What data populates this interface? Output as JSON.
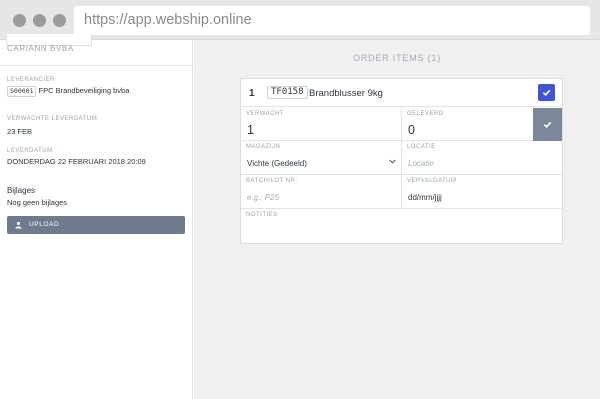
{
  "browser": {
    "url": "https://app.webship.online"
  },
  "sidebar": {
    "company": "CARIANN BVBA",
    "leverancier_label": "LEVERANCIER",
    "leverancier_code": "S00001",
    "leverancier_name": "FPC Brandbeveiliging bvba",
    "verwachte_label": "VERWACHTE LEVERDATUM",
    "verwachte_value": "23 FEB",
    "leverdatum_label": "LEVERDATUM",
    "leverdatum_value": "DONDERDAG 22 FEBRUARI 2018 20:09",
    "bijlages_title": "Bijlages",
    "bijlages_value": "Nog geen bijlages",
    "upload_label": "UPLOAD"
  },
  "main": {
    "title": "ORDER ITEMS (1)",
    "item": {
      "number": "1",
      "code": "TF0158",
      "name": "Brandblusser 9kg",
      "verwacht_label": "VERWACHT",
      "verwacht_value": "1",
      "geleverd_label": "GELEVERD",
      "geleverd_value": "0",
      "magazijn_label": "MAGAZIJN",
      "magazijn_value": "Vichte (Gedeeld)",
      "locatie_label": "LOCATIE",
      "locatie_placeholder": "Locatie",
      "batch_label": "BATCH/LOT NR.",
      "batch_placeholder": "e.g.: P25",
      "vervaldatum_label": "VERVALDATUM",
      "vervaldatum_value": "dd/mm/jjjj",
      "notities_label": "NOTITIES"
    }
  },
  "colors": {
    "accent": "#3f55d3",
    "button_gray": "#6f7b8d",
    "check_gray": "#7c8899"
  },
  "icons": [
    "upload-icon",
    "check-icon",
    "chevron-down-icon"
  ]
}
